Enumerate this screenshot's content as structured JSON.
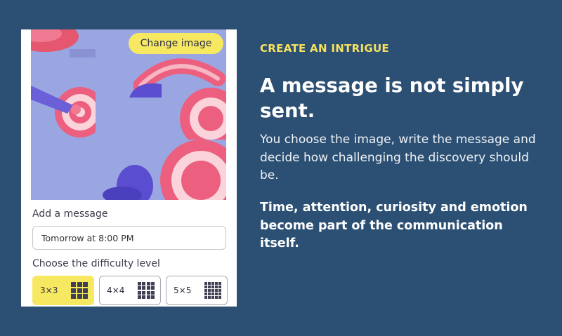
{
  "editor": {
    "change_image_label": "Change image",
    "message_label": "Add a message",
    "message_value": "Tomorrow at 8:00 PM",
    "difficulty_label": "Choose the difficulty level",
    "difficulty_options": [
      {
        "label": "3×3",
        "selected": true
      },
      {
        "label": "4×4",
        "selected": false
      },
      {
        "label": "5×5",
        "selected": false
      }
    ]
  },
  "promo": {
    "eyebrow": "CREATE AN INTRIGUE",
    "headline": "A message is not simply sent.",
    "body": "You choose the image, write the message and decide how challenging the discovery should be.",
    "emphasis": "Time, attention, curiosity and emotion become part of the communication itself."
  },
  "colors": {
    "background": "#2c5074",
    "accent_yellow": "#f6e861",
    "puzzle_background": "#9aa6e2",
    "target_pink": "#ec5f7e"
  },
  "icons": [
    "grid-3x3-icon",
    "grid-4x4-icon",
    "grid-5x5-icon"
  ]
}
